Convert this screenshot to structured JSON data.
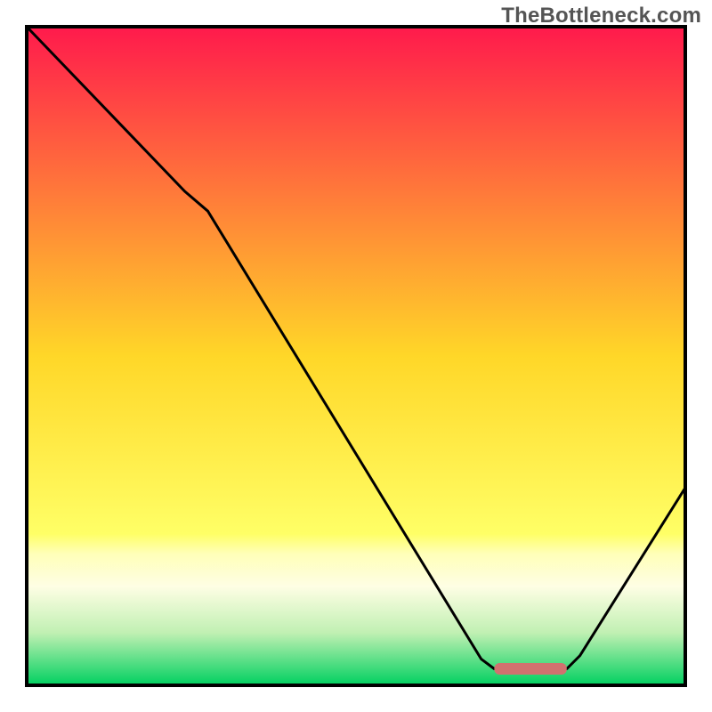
{
  "watermark": "TheBottleneck.com",
  "chart_data": {
    "type": "line",
    "title": "",
    "xlabel": "",
    "ylabel": "",
    "xlim": [
      0,
      100
    ],
    "ylim": [
      0,
      100
    ],
    "grid": false,
    "series": [
      {
        "name": "bottleneck-curve",
        "x": [
          0,
          24,
          27.5,
          69,
          71,
          82,
          84,
          100
        ],
        "values": [
          100,
          75,
          72,
          4,
          2.5,
          2.5,
          4.5,
          30
        ],
        "stroke": "#000000"
      }
    ],
    "marker": {
      "name": "optimal-range-bar",
      "x_start": 71,
      "x_end": 82,
      "y": 2.5,
      "color": "#d1716f"
    },
    "background_gradient": [
      {
        "offset": 0.0,
        "color": "#ff1a4c"
      },
      {
        "offset": 0.5,
        "color": "#ffd728"
      },
      {
        "offset": 0.77,
        "color": "#ffff66"
      },
      {
        "offset": 0.8,
        "color": "#ffffb8"
      },
      {
        "offset": 0.85,
        "color": "#fefee4"
      },
      {
        "offset": 0.92,
        "color": "#c1f0b3"
      },
      {
        "offset": 1.0,
        "color": "#00d060"
      }
    ]
  }
}
